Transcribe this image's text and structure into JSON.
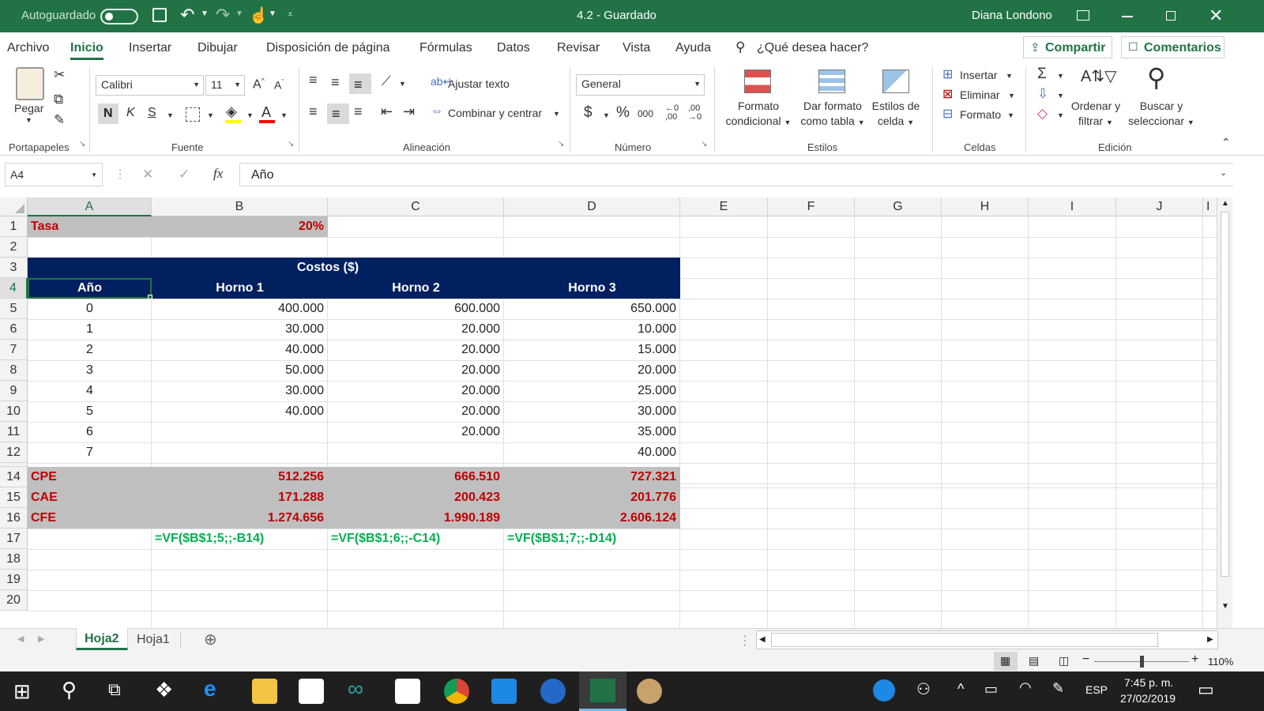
{
  "titlebar": {
    "autosave": "Autoguardado",
    "doc_title": "4.2  -  Guardado",
    "user": "Diana Londono"
  },
  "menu": [
    "Archivo",
    "Inicio",
    "Insertar",
    "Dibujar",
    "Disposición de página",
    "Fórmulas",
    "Datos",
    "Revisar",
    "Vista",
    "Ayuda"
  ],
  "tell_me": "¿Qué desea hacer?",
  "share": "Compartir",
  "comments": "Comentarios",
  "ribbon": {
    "groups": {
      "clipboard": "Portapapeles",
      "font": "Fuente",
      "alignment": "Alineación",
      "number": "Número",
      "styles": "Estilos",
      "cells": "Celdas",
      "editing": "Edición"
    },
    "paste": "Pegar",
    "font_name": "Calibri",
    "font_size": "11",
    "bold": "N",
    "italic": "K",
    "underline": "S",
    "wrap": "Ajustar texto",
    "merge": "Combinar y centrar",
    "number_format": "General",
    "currency": "$",
    "percent": "%",
    "thousands": "000",
    "cond1": "Formato",
    "cond2": "condicional",
    "tbl1": "Dar formato",
    "tbl2": "como tabla",
    "st1": "Estilos de",
    "st2": "celda",
    "insert": "Insertar",
    "delete": "Eliminar",
    "format": "Formato",
    "sort1": "Ordenar y",
    "sort2": "filtrar",
    "find1": "Buscar y",
    "find2": "seleccionar"
  },
  "formula_bar": {
    "name_box": "A4",
    "formula": "Año"
  },
  "columns": [
    "A",
    "B",
    "C",
    "D",
    "E",
    "F",
    "G",
    "H",
    "I",
    "J"
  ],
  "rows": [
    "1",
    "2",
    "3",
    "4",
    "5",
    "6",
    "7",
    "8",
    "9",
    "10",
    "11",
    "12",
    "14",
    "15",
    "16",
    "17",
    "18",
    "19",
    "20"
  ],
  "sheet": {
    "tasa_label": "Tasa",
    "tasa_value": "20%",
    "costos_header": "Costos ($)",
    "col_headers": [
      "Año",
      "Horno 1",
      "Horno 2",
      "Horno 3"
    ],
    "data": [
      [
        "0",
        "400.000",
        "600.000",
        "650.000"
      ],
      [
        "1",
        "30.000",
        "20.000",
        "10.000"
      ],
      [
        "2",
        "40.000",
        "20.000",
        "15.000"
      ],
      [
        "3",
        "50.000",
        "20.000",
        "20.000"
      ],
      [
        "4",
        "30.000",
        "20.000",
        "25.000"
      ],
      [
        "5",
        "40.000",
        "20.000",
        "30.000"
      ],
      [
        "6",
        "",
        "20.000",
        "35.000"
      ],
      [
        "7",
        "",
        "",
        "40.000"
      ]
    ],
    "summary": [
      [
        "CPE",
        "512.256",
        "666.510",
        "727.321"
      ],
      [
        "CAE",
        "171.288",
        "200.423",
        "201.776"
      ],
      [
        "CFE",
        "1.274.656",
        "1.990.189",
        "2.606.124"
      ]
    ],
    "formulas": [
      "=VF($B$1;5;;-B14)",
      "=VF($B$1;6;;-C14)",
      "=VF($B$1;7;;-D14)"
    ]
  },
  "tabs": [
    "Hoja2",
    "Hoja1"
  ],
  "zoom": "110%",
  "taskbar": {
    "lang": "ESP",
    "time": "7:45 p. m.",
    "date": "27/02/2019"
  },
  "colors": {
    "excel_green": "#217346",
    "header_navy": "#002060",
    "summary_gray": "#bfbfbf",
    "red_text": "#c00000",
    "formula_green": "#00b050"
  }
}
